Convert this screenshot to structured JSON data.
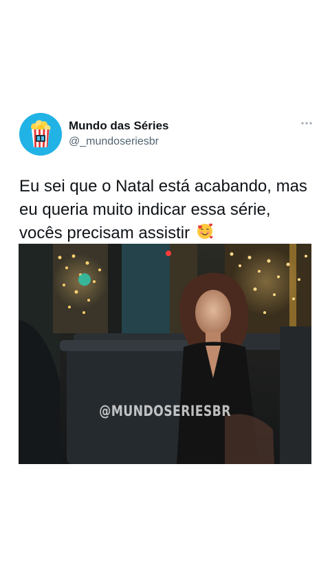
{
  "tweet": {
    "author_name": "Mundo das Séries",
    "author_handle": "@_mundoseriesbr",
    "more_icon": "more-horizontal-icon",
    "text": "Eu sei que o Natal está acabando, mas eu queria muito indicar essa série, vocês precisam assistir",
    "emoji": "smiling-face-with-hearts-icon"
  },
  "media": {
    "watermark": "@MUNDOSERIESBR"
  },
  "colors": {
    "avatar_bg": "#22b3e6",
    "name": "#0f1419",
    "handle": "#536471"
  }
}
